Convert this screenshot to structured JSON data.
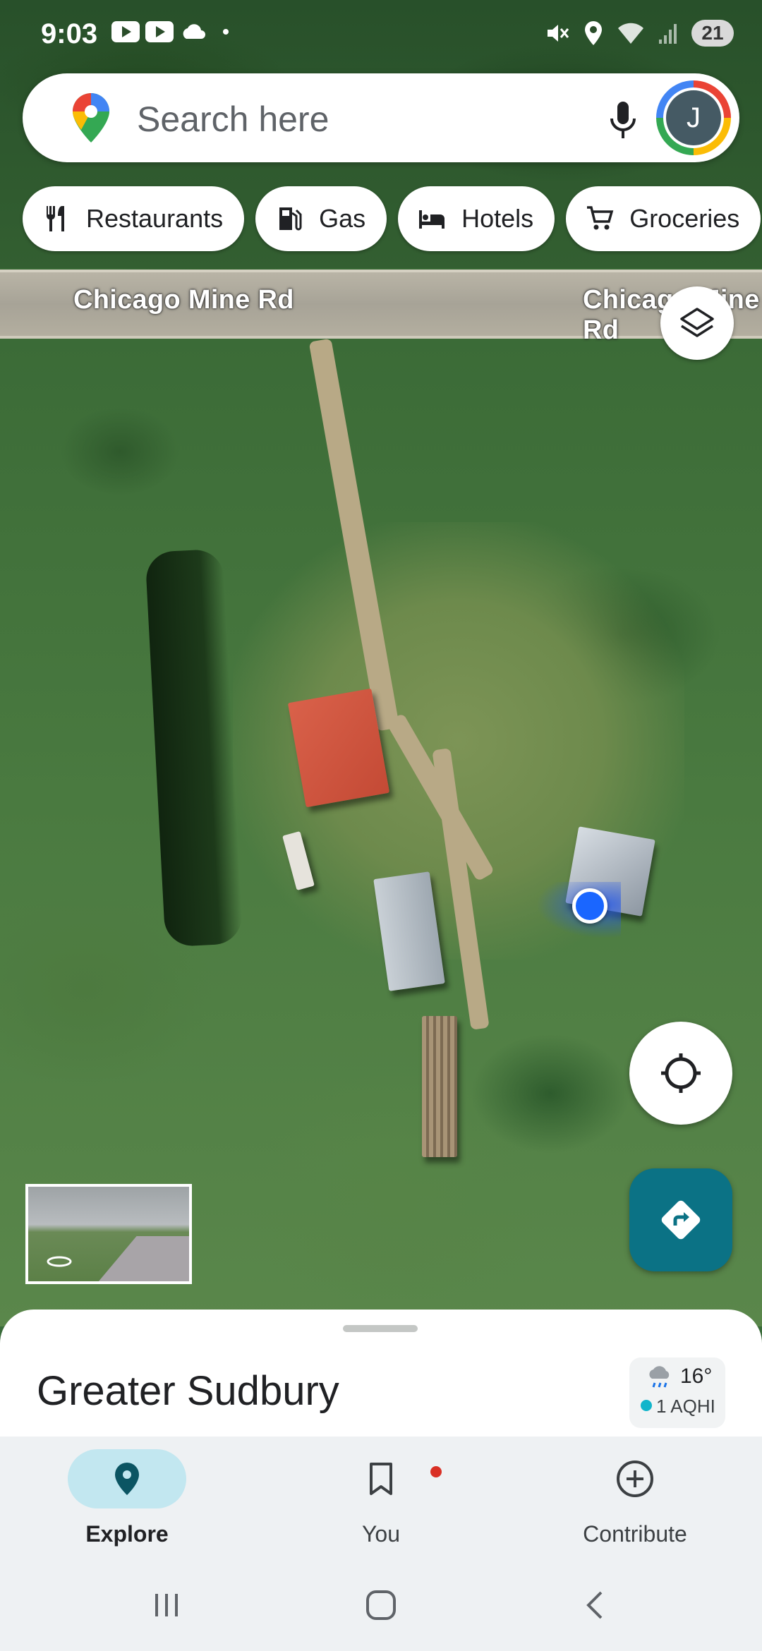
{
  "status_bar": {
    "time": "9:03",
    "battery": "21",
    "icons": [
      "youtube-icon",
      "youtube-icon",
      "cloud-icon",
      "dot-icon",
      "mute-icon",
      "location-icon",
      "wifi-icon",
      "signal-icon"
    ]
  },
  "search": {
    "placeholder": "Search here",
    "avatar_letter": "J"
  },
  "chips": [
    {
      "label": "Restaurants",
      "icon": "fork-knife-icon"
    },
    {
      "label": "Gas",
      "icon": "gas-pump-icon"
    },
    {
      "label": "Hotels",
      "icon": "bed-icon"
    },
    {
      "label": "Groceries",
      "icon": "cart-icon"
    }
  ],
  "map": {
    "road_labels": [
      "Chicago Mine Rd",
      "Chicago Mine Rd"
    ]
  },
  "sheet": {
    "place": "Greater Sudbury",
    "weather": {
      "temp": "16°",
      "aqi": "1 AQHI"
    }
  },
  "nav": {
    "items": [
      {
        "label": "Explore",
        "icon": "pin-icon",
        "active": true
      },
      {
        "label": "You",
        "icon": "bookmark-icon",
        "active": false
      },
      {
        "label": "Contribute",
        "icon": "add-circle-icon",
        "active": false
      }
    ]
  },
  "colors": {
    "accent": "#0b7285",
    "explore_pill": "#c2e7f0",
    "location_dot": "#1a66ff"
  }
}
